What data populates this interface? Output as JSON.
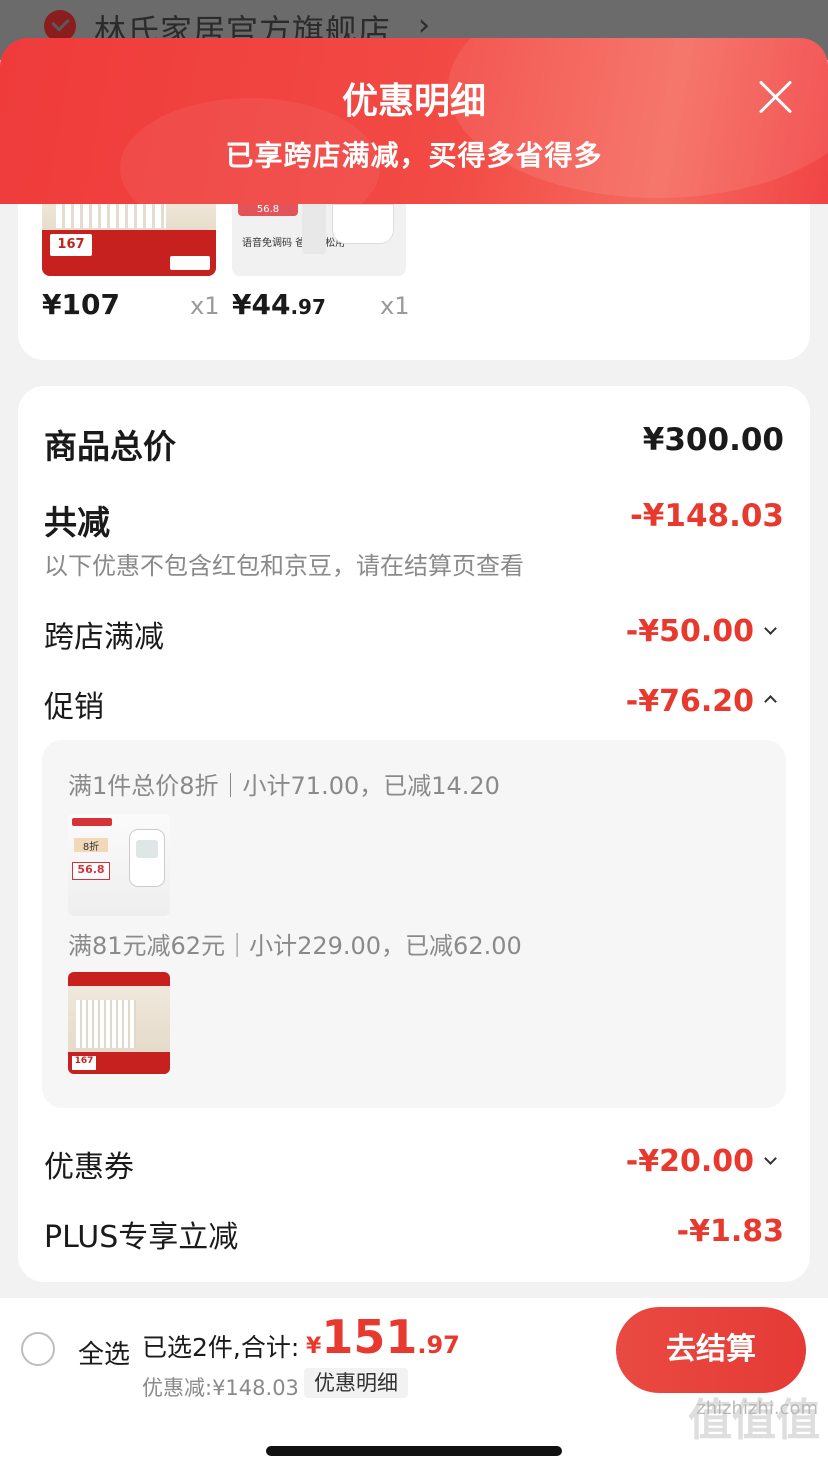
{
  "store": {
    "name": "林氏家居官方旗舰店",
    "chevron": "›"
  },
  "sheet": {
    "title": "优惠明细",
    "subtitle": "已享跨店满减，买得多省得多"
  },
  "products": [
    {
      "price": "¥107",
      "price_decimal": "",
      "qty": "x1",
      "thumb_price": "167"
    },
    {
      "price": "¥44",
      "price_decimal": ".97",
      "qty": "x1",
      "thumb_price": "56.8",
      "thumb_text": "语音免调码 爸妈轻松用"
    }
  ],
  "breakdown": {
    "total_label": "商品总价",
    "total_value": "¥300.00",
    "reduce_label": "共减",
    "reduce_value": "-¥148.03",
    "note": "以下优惠不包含红包和京豆，请在结算页查看",
    "cross_store_label": "跨店满减",
    "cross_store_value": "-¥50.00",
    "promo_label": "促销",
    "promo_value": "-¥76.20",
    "promo_items": [
      {
        "text": "满1件总价8折｜小计71.00，已减14.20",
        "thumb_price": "56.8",
        "thumb_off": "8折"
      },
      {
        "text": "满81元减62元｜小计229.00，已减62.00",
        "thumb_price": "167"
      }
    ],
    "coupon_label": "优惠券",
    "coupon_value": "-¥20.00",
    "plus_label": "PLUS专享立减",
    "plus_value": "-¥1.83"
  },
  "bottom": {
    "select_all": "全选",
    "selected": "已选2件,合计:",
    "total_currency": "¥",
    "total_int": "151",
    "total_dec": ".97",
    "discount": "优惠减:¥148.03",
    "detail_chip": "优惠明细",
    "checkout": "去结算"
  },
  "watermark": {
    "text": "zhizhizhi.com",
    "mark": "值值值"
  },
  "colors": {
    "accent_red": "#e8392f",
    "header_red": "#ef3b3b"
  }
}
